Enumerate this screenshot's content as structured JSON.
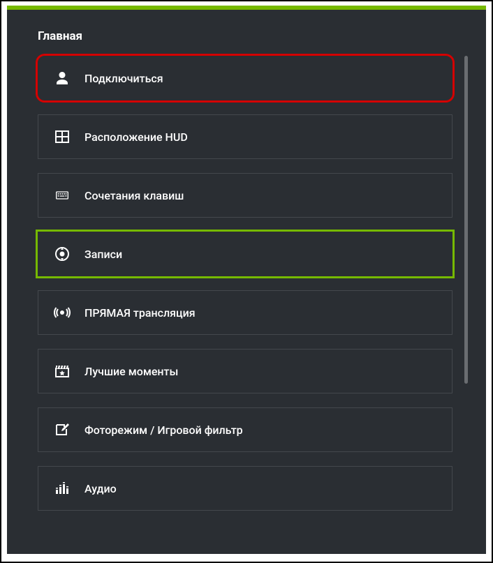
{
  "heading": "Главная",
  "menu": {
    "connect": {
      "label": "Подключиться"
    },
    "hud": {
      "label": "Расположение HUD"
    },
    "shortcuts": {
      "label": "Сочетания клавиш"
    },
    "recordings": {
      "label": "Записи"
    },
    "broadcast": {
      "label": "ПРЯМАЯ трансляция"
    },
    "highlights": {
      "label": "Лучшие моменты"
    },
    "photomode": {
      "label": "Фоторежим / Игровой фильтр"
    },
    "audio": {
      "label": "Аудио"
    }
  }
}
